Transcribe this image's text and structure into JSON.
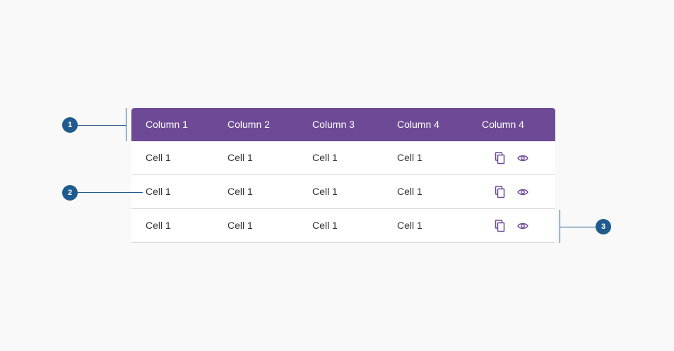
{
  "table": {
    "headers": [
      "Column 1",
      "Column 2",
      "Column 3",
      "Column 4",
      "Column 4"
    ],
    "rows": [
      {
        "cells": [
          "Cell 1",
          "Cell 1",
          "Cell 1",
          "Cell 1"
        ]
      },
      {
        "cells": [
          "Cell 1",
          "Cell 1",
          "Cell 1",
          "Cell 1"
        ]
      },
      {
        "cells": [
          "Cell 1",
          "Cell 1",
          "Cell 1",
          "Cell 1"
        ]
      }
    ],
    "row_actions": [
      "copy-icon",
      "eye-icon"
    ]
  },
  "callouts": [
    "1",
    "2",
    "3"
  ],
  "colors": {
    "header_bg": "#6e4a96",
    "icon": "#6e4a96",
    "callout": "#1f5b8e",
    "row_border": "#d8d8d8"
  }
}
